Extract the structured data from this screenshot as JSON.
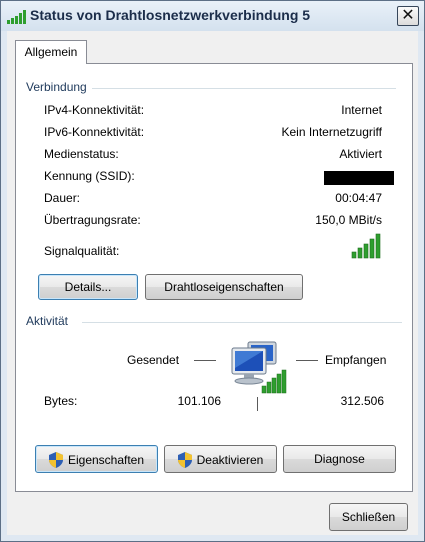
{
  "window": {
    "title": "Status von Drahtlosnetzwerkverbindung 5",
    "close_glyph": "✕"
  },
  "tab": {
    "label": "Allgemein"
  },
  "connection": {
    "section_title": "Verbindung",
    "rows": [
      {
        "label": "IPv4-Konnektivität:",
        "value": "Internet"
      },
      {
        "label": "IPv6-Konnektivität:",
        "value": "Kein Internetzugriff"
      },
      {
        "label": "Medienstatus:",
        "value": "Aktiviert"
      },
      {
        "label": "Kennung (SSID):",
        "value": ""
      },
      {
        "label": "Dauer:",
        "value": "00:04:47"
      },
      {
        "label": "Übertragungsrate:",
        "value": "150,0 MBit/s"
      }
    ],
    "signal_label": "Signalqualität:",
    "signal_bars": 5,
    "signal_bars_total": 5,
    "details_button": "Details...",
    "wireless_props_button": "Drahtloseigenschaften"
  },
  "activity": {
    "section_title": "Aktivität",
    "sent_label": "Gesendet",
    "received_label": "Empfangen",
    "bytes_label": "Bytes:",
    "bytes_sent": "101.106",
    "bytes_received": "312.506"
  },
  "actions": {
    "properties_button": "Eigenschaften",
    "disable_button": "Deaktivieren",
    "diagnose_button": "Diagnose"
  },
  "footer": {
    "close_button": "Schließen"
  },
  "colors": {
    "signal_green": "#2e9e2e",
    "title_text": "#1b2d4a",
    "section_text": "#1e395b"
  },
  "icons": [
    "signal-bars-icon",
    "close-icon",
    "network-computers-icon",
    "shield-icon"
  ]
}
